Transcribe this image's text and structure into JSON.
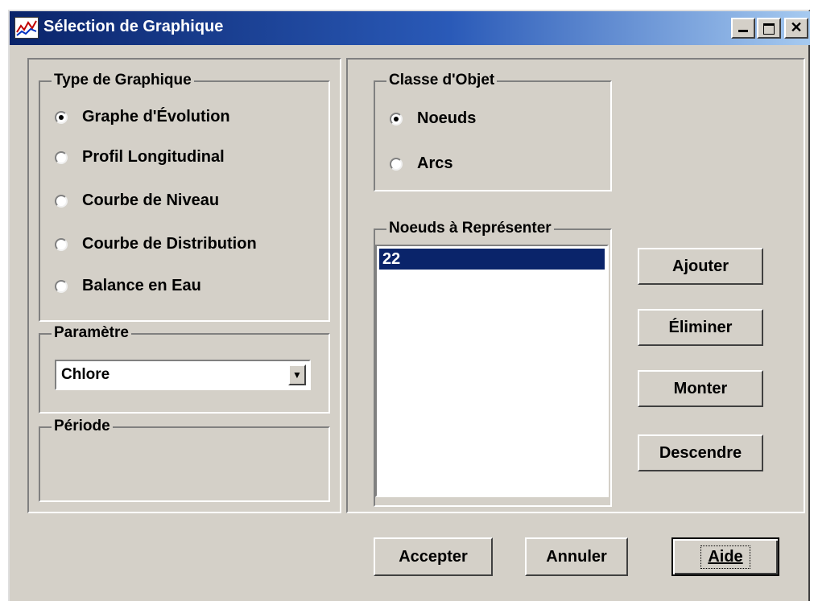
{
  "window": {
    "title": "Sélection de Graphique"
  },
  "type_group": {
    "label": "Type de Graphique",
    "options": [
      "Graphe d'Évolution",
      "Profil Longitudinal",
      "Courbe de Niveau",
      "Courbe de Distribution",
      "Balance en Eau"
    ],
    "selected": "Graphe d'Évolution"
  },
  "param_group": {
    "label": "Paramètre",
    "value": "Chlore"
  },
  "period_group": {
    "label": "Période"
  },
  "class_group": {
    "label": "Classe d'Objet",
    "options": [
      "Noeuds",
      "Arcs"
    ],
    "selected": "Noeuds"
  },
  "nodes_group": {
    "label": "Noeuds à Représenter",
    "items": [
      "22"
    ]
  },
  "side_buttons": {
    "add": "Ajouter",
    "remove": "Éliminer",
    "up": "Monter",
    "down": "Descendre"
  },
  "footer": {
    "accept": "Accepter",
    "cancel": "Annuler",
    "help": "Aide"
  },
  "colors": {
    "face": "#d4d0c8",
    "title_start": "#0a246a",
    "title_end": "#a6caf0",
    "selection": "#0a246a"
  }
}
